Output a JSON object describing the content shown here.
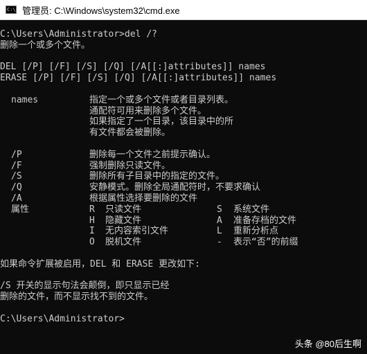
{
  "window": {
    "title": "管理员: C:\\Windows\\system32\\cmd.exe",
    "icon": "cmd-window-icon",
    "icon_glyph": "C:\\"
  },
  "console": {
    "prompt1": "C:\\Users\\Administrator>del /?",
    "desc": "删除一个或多个文件。",
    "usage1": "DEL [/P] [/F] [/S] [/Q] [/A[[:]attributes]] names",
    "usage2": "ERASE [/P] [/F] [/S] [/Q] [/A[[:]attributes]] names",
    "names": {
      "label": "names",
      "lines": [
        "指定一个或多个文件或者目录列表。",
        "通配符可用来删除多个文件。",
        "如果指定了一个目录，该目录中的所",
        "有文件都会被删除。"
      ]
    },
    "options": [
      {
        "flag": "/P",
        "text": "删除每一个文件之前提示确认。"
      },
      {
        "flag": "/F",
        "text": "强制删除只读文件。"
      },
      {
        "flag": "/S",
        "text": "删除所有子目录中的指定的文件。"
      },
      {
        "flag": "/Q",
        "text": "安静模式。删除全局通配符时，不要求确认"
      },
      {
        "flag": "/A",
        "text": "根据属性选择要删除的文件"
      }
    ],
    "attr_label": "属性",
    "attrs": [
      {
        "k1": "R",
        "v1": "只读文件",
        "k2": "S",
        "v2": "系统文件"
      },
      {
        "k1": "H",
        "v1": "隐藏文件",
        "k2": "A",
        "v2": "准备存档的文件"
      },
      {
        "k1": "I",
        "v1": "无内容索引文件",
        "k2": "L",
        "v2": "重新分析点"
      },
      {
        "k1": "O",
        "v1": "脱机文件",
        "k2": "-",
        "v2": "表示“否”的前缀"
      }
    ],
    "ext": "如果命令扩展被启用，DEL 和 ERASE 更改如下:",
    "s1": "/S 开关的显示句法会颠倒，即只显示已经",
    "s2": "删除的文件，而不显示找不到的文件。",
    "prompt2": "C:\\Users\\Administrator>"
  },
  "watermark": {
    "text": "头条 @80后生啊"
  }
}
